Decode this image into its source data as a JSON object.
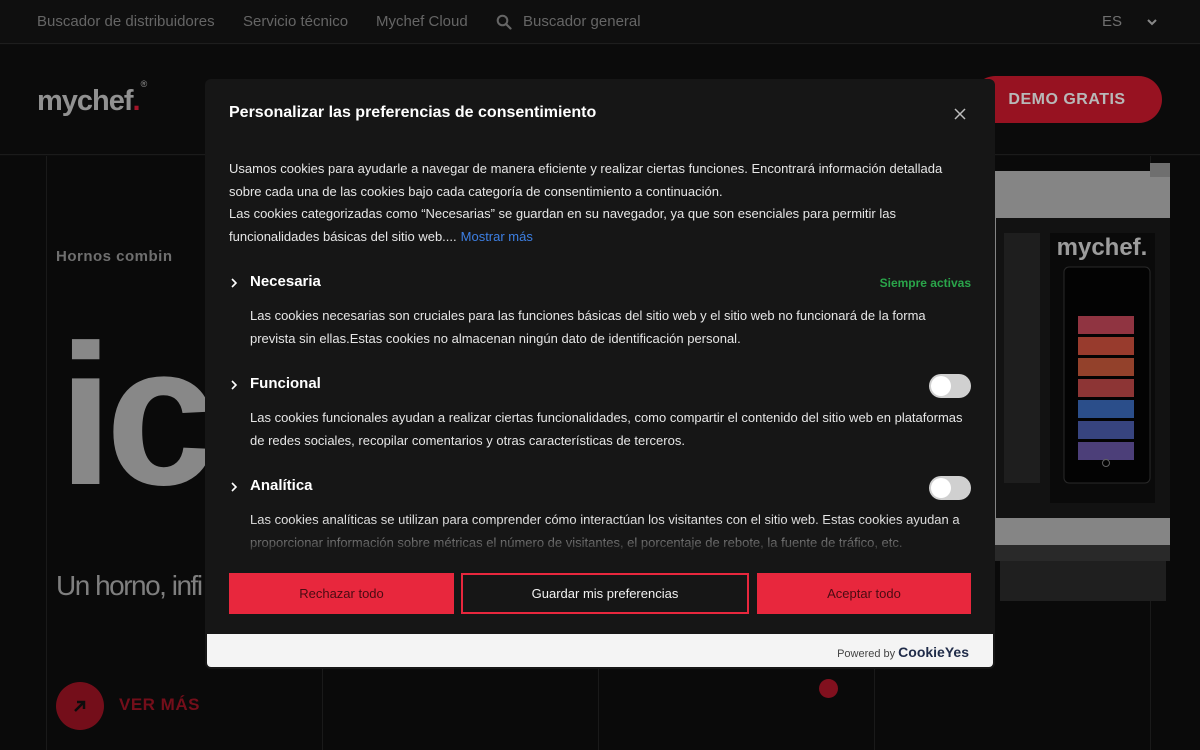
{
  "topbar": {
    "links": [
      "Buscador de distribuidores",
      "Servicio técnico",
      "Mychef Cloud"
    ],
    "search_label": "Buscador general",
    "language": "ES"
  },
  "header": {
    "logo_text": "mychef",
    "logo_dot": ".",
    "logo_reg": "®",
    "demo_button": "DEMO GRATIS"
  },
  "hero": {
    "subtitle": "Hornos combin",
    "big_text": "ic",
    "tagline": "Un horno, infi",
    "cta_label": "VER MÁS",
    "oven_logo": "mychef."
  },
  "modal": {
    "title": "Personalizar las preferencias de consentimiento",
    "intro_line1": "Usamos cookies para ayudarle a navegar de manera eficiente y realizar ciertas funciones. Encontrará información detallada sobre cada una de las cookies bajo cada categoría de consentimiento a continuación.",
    "intro_line2": "Las cookies categorizadas como “Necesarias” se guardan en su navegador, ya que son esenciales para permitir las funcionalidades básicas del sitio web....",
    "show_more": "Mostrar más",
    "categories": [
      {
        "name": "Necesaria",
        "status": "Siempre activas",
        "description": "Las cookies necesarias son cruciales para las funciones básicas del sitio web y el sitio web no funcionará de la forma prevista sin ellas.Estas cookies no almacenan ningún dato de identificación personal."
      },
      {
        "name": "Funcional",
        "enabled": false,
        "description": "Las cookies funcionales ayudan a realizar ciertas funcionalidades, como compartir el contenido del sitio web en plataformas de redes sociales, recopilar comentarios y otras características de terceros."
      },
      {
        "name": "Analítica",
        "enabled": false,
        "description": "Las cookies analíticas se utilizan para comprender cómo interactúan los visitantes con el sitio web. Estas cookies ayudan a proporcionar información sobre métricas el número de visitantes, el porcentaje de rebote, la fuente de tráfico, etc."
      }
    ],
    "buttons": {
      "reject": "Rechazar todo",
      "save": "Guardar mis preferencias",
      "accept": "Aceptar todo"
    },
    "footer": {
      "powered_by": "Powered by",
      "brand": "CookieYes"
    }
  },
  "colors": {
    "accent": "#e8273d",
    "always_active": "#2aa54a",
    "link": "#3d7fe3",
    "background": "#121212"
  }
}
